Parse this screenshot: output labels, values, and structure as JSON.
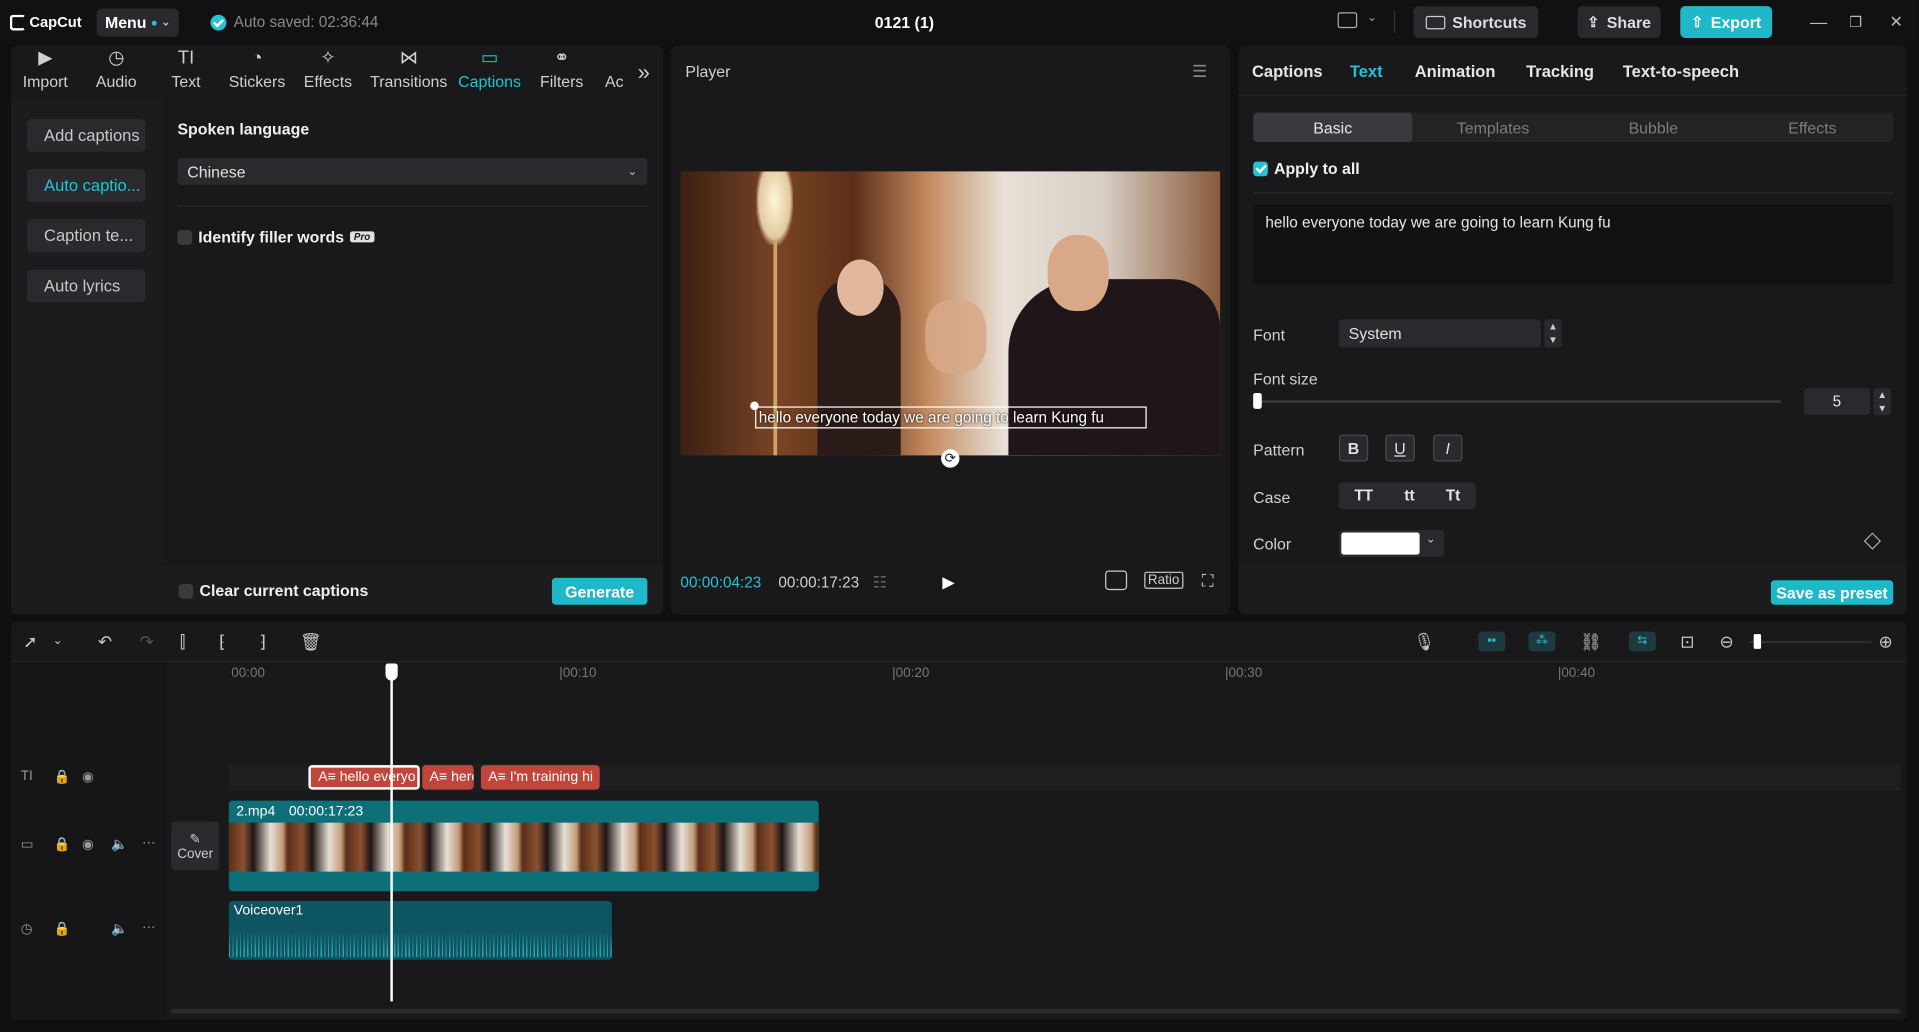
{
  "app": {
    "name": "CapCut",
    "menu_label": "Menu",
    "autosave": "Auto saved: 02:36:44",
    "project_title": "0121 (1)"
  },
  "header": {
    "shortcuts": "Shortcuts",
    "share": "Share",
    "export": "Export",
    "minimize": "—",
    "restore": "❐",
    "close": "✕"
  },
  "left_tabs": [
    {
      "label": "Import",
      "icon": "▶"
    },
    {
      "label": "Audio",
      "icon": "◷"
    },
    {
      "label": "Text",
      "icon": "TI"
    },
    {
      "label": "Stickers",
      "icon": "◔"
    },
    {
      "label": "Effects",
      "icon": "✧"
    },
    {
      "label": "Transitions",
      "icon": "⋈"
    },
    {
      "label": "Captions",
      "icon": "▭"
    },
    {
      "label": "Filters",
      "icon": "⚭"
    },
    {
      "label": "Ac",
      "icon": ""
    }
  ],
  "left_nav": [
    "Add captions",
    "Auto captio...",
    "Caption te...",
    "Auto lyrics"
  ],
  "captions_panel": {
    "spoken_language_label": "Spoken language",
    "language": "Chinese",
    "identify_filler": "Identify filler words",
    "pro_badge": "Pro",
    "clear_captions": "Clear current captions",
    "generate": "Generate"
  },
  "player": {
    "title": "Player",
    "caption_text": "hello everyone today we are going to learn Kung fu",
    "current_time": "00:00:04:23",
    "total_time": "00:00:17:23",
    "ratio": "Ratio"
  },
  "right_panel": {
    "tabs": [
      "Captions",
      "Text",
      "Animation",
      "Tracking",
      "Text-to-speech"
    ],
    "active_tab": "Text",
    "subtabs": [
      "Basic",
      "Templates",
      "Bubble",
      "Effects"
    ],
    "apply_all": "Apply to all",
    "text_value": "hello everyone today we are going to learn Kung fu",
    "font_label": "Font",
    "font_value": "System",
    "font_size_label": "Font size",
    "font_size_value": "5",
    "pattern_label": "Pattern",
    "case_label": "Case",
    "case_options": [
      "TT",
      "tt",
      "Tt"
    ],
    "color_label": "Color",
    "color_value": "#ffffff",
    "save_preset": "Save as preset"
  },
  "timeline": {
    "ruler": [
      "00:00",
      "|00:10",
      "|00:20",
      "|00:30",
      "|00:40"
    ],
    "text_clips": [
      "A≡ hello everyo",
      "A≡ here",
      "A≡ I'm training hi"
    ],
    "video_clip": {
      "name": "2.mp4",
      "duration": "00:00:17:23"
    },
    "cover_label": "Cover",
    "audio_clip": "Voiceover1"
  },
  "colors": {
    "accent": "#1fb8c8",
    "text_clip": "#c0453a",
    "video_track": "#0d6f78",
    "audio_track": "#0d5560"
  }
}
